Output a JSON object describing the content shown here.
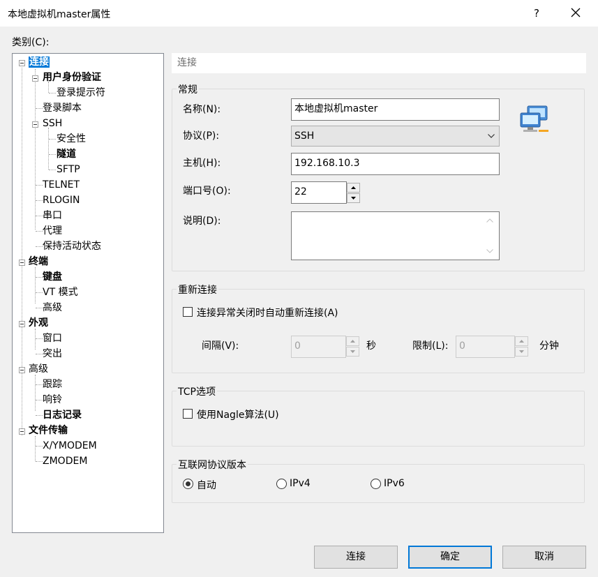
{
  "window": {
    "title": "本地虚拟机master属性",
    "help": "?"
  },
  "category_label": "类别(C):",
  "tree": {
    "connection": "连接",
    "auth": "用户身份验证",
    "login_prompt": "登录提示符",
    "login_script": "登录脚本",
    "ssh": "SSH",
    "security": "安全性",
    "tunnel": "隧道",
    "sftp": "SFTP",
    "telnet": "TELNET",
    "rlogin": "RLOGIN",
    "serial": "串口",
    "proxy": "代理",
    "keepalive": "保持活动状态",
    "terminal": "终端",
    "keyboard": "键盘",
    "vt_mode": "VT 模式",
    "advanced_term": "高级",
    "appearance": "外观",
    "window": "窗口",
    "highlight": "突出",
    "advanced": "高级",
    "trace": "跟踪",
    "bell": "响铃",
    "logging": "日志记录",
    "file_transfer": "文件传输",
    "xymodem": "X/YMODEM",
    "zmodem": "ZMODEM"
  },
  "header": "连接",
  "general": {
    "title": "常规",
    "name_label": "名称(N):",
    "name_value": "本地虚拟机master",
    "protocol_label": "协议(P):",
    "protocol_value": "SSH",
    "host_label": "主机(H):",
    "host_value": "192.168.10.3",
    "port_label": "端口号(O):",
    "port_value": "22",
    "desc_label": "说明(D):",
    "desc_value": ""
  },
  "reconnect": {
    "title": "重新连接",
    "checkbox_label": "连接异常关闭时自动重新连接(A)",
    "interval_label": "间隔(V):",
    "interval_value": "0",
    "interval_unit": "秒",
    "limit_label": "限制(L):",
    "limit_value": "0",
    "limit_unit": "分钟"
  },
  "tcp": {
    "title": "TCP选项",
    "nagle_label": "使用Nagle算法(U)"
  },
  "ip_version": {
    "title": "互联网协议版本",
    "auto": "自动",
    "ipv4": "IPv4",
    "ipv6": "IPv6"
  },
  "buttons": {
    "connect": "连接",
    "ok": "确定",
    "cancel": "取消"
  }
}
